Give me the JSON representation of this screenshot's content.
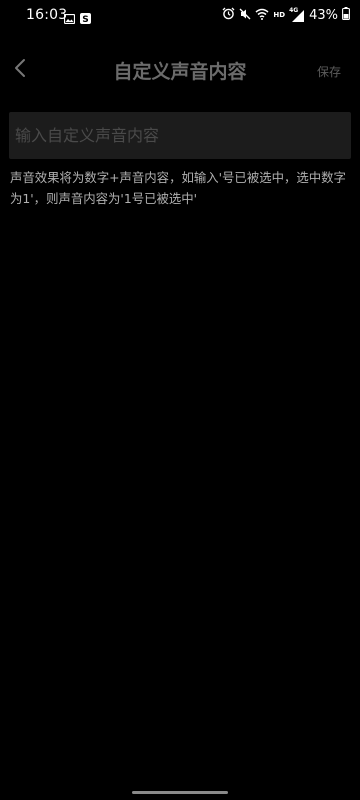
{
  "status_bar": {
    "time": "16:03",
    "battery": "43%",
    "network_label": "4G",
    "hd_label": "HD",
    "icons": [
      "image-icon",
      "s-badge-icon",
      "alarm-icon",
      "mute-icon",
      "wifi-icon",
      "signal-icon",
      "battery-icon"
    ]
  },
  "app_bar": {
    "title": "自定义声音内容",
    "save_label": "保存",
    "back_icon": "chevron-left-icon"
  },
  "input": {
    "placeholder": "输入自定义声音内容",
    "value": ""
  },
  "hint": {
    "text": "声音效果将为数字+声音内容，如输入'号已被选中，选中数字为1'，则声音内容为'1号已被选中'"
  }
}
